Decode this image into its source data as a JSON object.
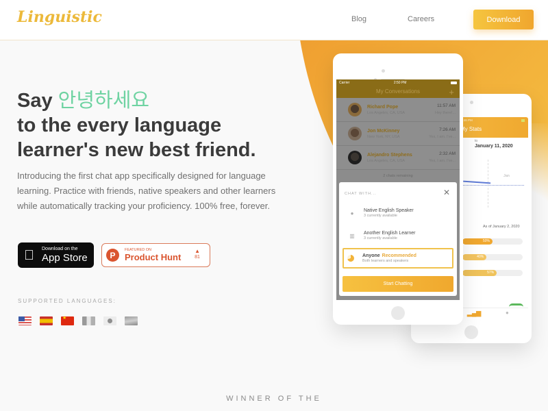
{
  "header": {
    "logo": "Linguistic",
    "nav": [
      {
        "label": "Blog"
      },
      {
        "label": "Careers"
      }
    ],
    "download_label": "Download"
  },
  "colors": {
    "brand": "#ecb93a",
    "accent_orange": "#f0a62e",
    "korean_green": "#6fd3a2",
    "product_hunt": "#da552f"
  },
  "hero": {
    "headline_prefix": "Say",
    "headline_korean": "안녕하세요",
    "headline_line2": "to the every language",
    "headline_line3": "learner's new best friend.",
    "intro": "Introducing the first chat app specifically designed for language learning. Practice with friends, native speakers and other learners while automatically tracking your proficiency. 100% free, forever."
  },
  "badges": {
    "appstore_small": "Download on the",
    "appstore_big": "App Store",
    "producthunt_small": "FEATURED ON",
    "producthunt_big": "Product Hunt",
    "producthunt_logo": "P",
    "producthunt_votes": "81"
  },
  "languages": {
    "label": "SUPPORTED LANGUAGES:",
    "flags": [
      "us-flag",
      "spain-flag",
      "china-flag",
      "flag-grayed-1",
      "flag-grayed-2",
      "flag-grayed-3"
    ]
  },
  "front_phone": {
    "status_carrier": "Carrier",
    "status_time": "2:50 PM",
    "title": "My Conversations",
    "add_icon": "+",
    "conversations": [
      {
        "name": "Richard Pope",
        "location": "Los Angeles, CA, USA",
        "time": "11:57 AM",
        "message": "Hey there!..."
      },
      {
        "name": "Jon McKinney",
        "location": "New York, NY, USA",
        "time": "7:26 AM",
        "message": "Yes, I am. I've..."
      },
      {
        "name": "Alejandro Stephens",
        "location": "Los Angeles, CA, USA",
        "time": "2:32 AM",
        "message": "Yes, I am. I've..."
      }
    ],
    "remaining": "2 chats remaining",
    "modal": {
      "title": "CHAT WITH...",
      "close": "✕",
      "options": [
        {
          "name": "Native English Speaker",
          "sub": "3 currently available"
        },
        {
          "name": "Another English Learner",
          "sub": "3 currently available"
        },
        {
          "name": "Anyone",
          "tag": "Recommended",
          "sub": "Both learners and speakers"
        }
      ],
      "start_label": "Start Chatting"
    }
  },
  "back_phone": {
    "status_time": "8:46 PM",
    "title": "My Stats",
    "to_label": "to",
    "to_date": "January 11, 2020",
    "chart_label": "Jan",
    "as_of": "As of January 2, 2020",
    "bars": [
      {
        "label": "50%",
        "value": 50
      },
      {
        "label": "40%",
        "value": 40
      },
      {
        "label": "57%",
        "value": 57
      }
    ]
  },
  "winner_text": "WINNER OF THE"
}
